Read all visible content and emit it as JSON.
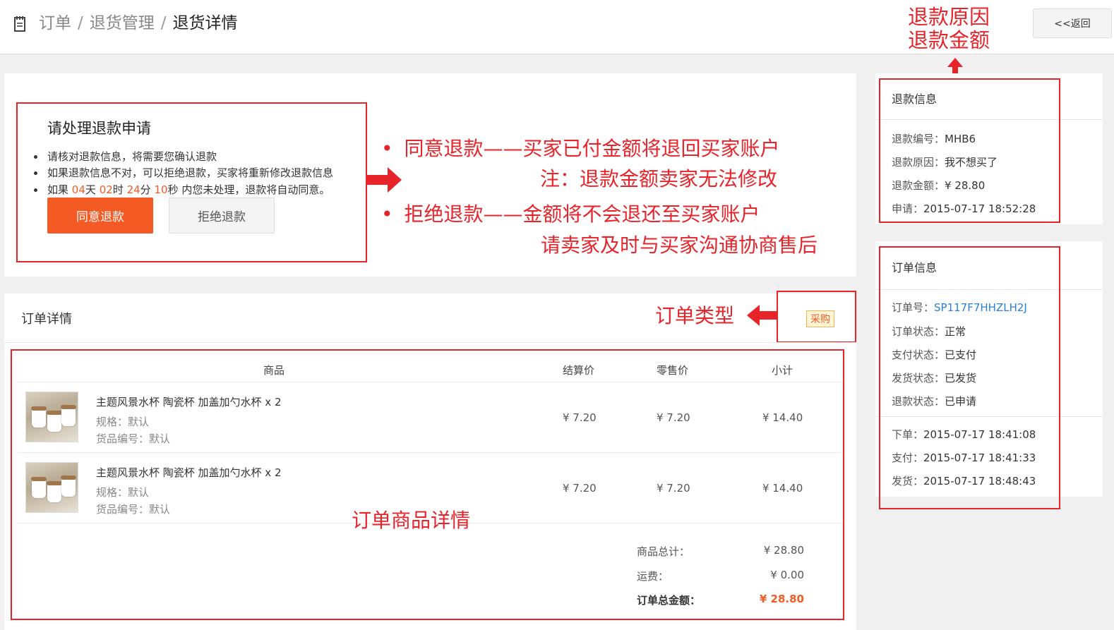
{
  "breadcrumb": {
    "items": [
      "订单",
      "退货管理"
    ],
    "separator": "/",
    "current": "退货详情"
  },
  "back_button": "<<返回",
  "refund_request": {
    "title": "请处理退款申请",
    "notices": [
      "请核对退款信息，将需要您确认退款",
      "如果退款信息不对，可以拒绝退款，买家将重新修改退款信息"
    ],
    "countdown": {
      "prefix": "如果",
      "days": "04",
      "days_unit": "天",
      "hours": "02",
      "hours_unit": "时",
      "minutes": "24",
      "minutes_unit": "分",
      "seconds": "10",
      "seconds_unit": "秒",
      "suffix": "内您未处理，退款将自动同意。"
    },
    "agree_button": "同意退款",
    "reject_button": "拒绝退款"
  },
  "annotations": {
    "agree_line": "同意退款——买家已付金额将退回买家账户",
    "agree_note": "注：退款金额卖家无法修改",
    "reject_line": "拒绝退款——金额将不会退还至买家账户",
    "reject_note": "请卖家及时与买家沟通协商售后",
    "refund_reason_amount": [
      "退款原因",
      "退款金额"
    ],
    "order_type": "订单类型",
    "order_goods": "订单商品详情"
  },
  "order_detail": {
    "title": "订单详情",
    "type_badge": "采购",
    "columns": [
      "商品",
      "结算价",
      "零售价",
      "小计"
    ],
    "items": [
      {
        "name": "主题风景水杯 陶瓷杯 加盖加勺水杯 x 2",
        "spec": "规格：默认",
        "code": "货品编号：默认",
        "settle_price": "¥ 7.20",
        "retail_price": "¥ 7.20",
        "subtotal": "¥ 14.40"
      },
      {
        "name": "主题风景水杯 陶瓷杯 加盖加勺水杯 x 2",
        "spec": "规格：默认",
        "code": "货品编号：默认",
        "settle_price": "¥ 7.20",
        "retail_price": "¥ 7.20",
        "subtotal": "¥ 14.40"
      }
    ],
    "summary": {
      "goods_total_label": "商品总计：",
      "goods_total": "¥ 28.80",
      "shipping_label": "运费：",
      "shipping": "¥ 0.00",
      "order_total_label": "订单总金额：",
      "order_total": "¥ 28.80"
    }
  },
  "refund_info": {
    "title": "退款信息",
    "number_label": "退款编号：",
    "number": "MHB6",
    "reason_label": "退款原因：",
    "reason": "我不想买了",
    "amount_label": "退款金额：",
    "amount": "¥ 28.80",
    "applied_label": "申请：",
    "applied": "2015-07-17 18:52:28"
  },
  "order_info": {
    "title": "订单信息",
    "order_no_label": "订单号：",
    "order_no": "SP117F7HHZLH2J",
    "order_status_label": "订单状态：",
    "order_status": "正常",
    "pay_status_label": "支付状态：",
    "pay_status": "已支付",
    "ship_status_label": "发货状态：",
    "ship_status": "已发货",
    "refund_status_label": "退款状态：",
    "refund_status": "已申请",
    "placed_label": "下单：",
    "placed": "2015-07-17 18:41:08",
    "paid_label": "支付：",
    "paid": "2015-07-17 18:41:33",
    "shipped_label": "发货：",
    "shipped": "2015-07-17 18:48:43"
  },
  "colors": {
    "accent": "#f45a24",
    "annotation_red": "#e8242b",
    "link_blue": "#2a7fd6"
  }
}
